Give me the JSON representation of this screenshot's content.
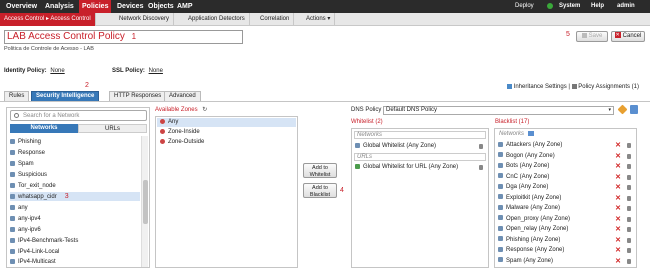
{
  "topnav": {
    "items": [
      "Overview",
      "Analysis",
      "Policies",
      "Devices",
      "Objects",
      "AMP"
    ],
    "deploy": "Deploy",
    "system": "System",
    "help": "Help",
    "user": "admin"
  },
  "subnav": {
    "items": [
      "Access Control ▸ Access Control",
      "Network Discovery",
      "Application Detectors",
      "Correlation",
      "Actions ▾"
    ]
  },
  "policy": {
    "name": "LAB Access Control Policy",
    "description": "Politica de Controle de Acesso - LAB",
    "identity_label": "Identity Policy:",
    "identity_value": "None",
    "ssl_label": "SSL Policy:",
    "ssl_value": "None"
  },
  "buttons": {
    "save": "Save",
    "cancel": "Cancel",
    "add_whitelist": "Add to Whitelist",
    "add_blacklist": "Add to Blacklist"
  },
  "links": {
    "inheritance": "Inheritance Settings",
    "separator": "|",
    "assignments": "Policy Assignments (1)"
  },
  "tabs": [
    "Rules",
    "Security Intelligence",
    "HTTP Responses",
    "Advanced"
  ],
  "markers": {
    "m1": "1",
    "m2": "2",
    "m3": "3",
    "m4": "4",
    "m5": "5"
  },
  "left": {
    "search_placeholder": "Search for a Network",
    "tab_networks": "Networks",
    "tab_urls": "URLs",
    "items": [
      "Phishing",
      "Response",
      "Spam",
      "Suspicious",
      "Tor_exit_node",
      "whatsapp_cidr",
      "any",
      "any-ipv4",
      "any-ipv6",
      "IPv4-Benchmark-Tests",
      "IPv4-Link-Local",
      "IPv4-Multicast"
    ]
  },
  "zones": {
    "header": "Available Zones",
    "items": [
      "Any",
      "Zone-Inside",
      "Zone-Outside"
    ]
  },
  "dns": {
    "label": "DNS Policy",
    "value": "Default DNS Policy"
  },
  "whitelist": {
    "header": "Whitelist (2)",
    "networks_label": "Networks",
    "urls_label": "URLs",
    "networks": [
      "Global Whitelist (Any Zone)"
    ],
    "urls": [
      "Global Whitelist for URL (Any Zone)"
    ]
  },
  "blacklist": {
    "header": "Blacklist (17)",
    "networks_label": "Networks",
    "items": [
      "Attackers (Any Zone)",
      "Bogon (Any Zone)",
      "Bots (Any Zone)",
      "CnC (Any Zone)",
      "Dga (Any Zone)",
      "Exploitkit (Any Zone)",
      "Malware (Any Zone)",
      "Open_proxy (Any Zone)",
      "Open_relay (Any Zone)",
      "Phishing (Any Zone)",
      "Response (Any Zone)",
      "Spam (Any Zone)"
    ]
  },
  "colors": {
    "accent": "#c8202a",
    "tab_active": "#3778b8",
    "selected": "#d6e4f5",
    "marker": "#d0202a"
  }
}
